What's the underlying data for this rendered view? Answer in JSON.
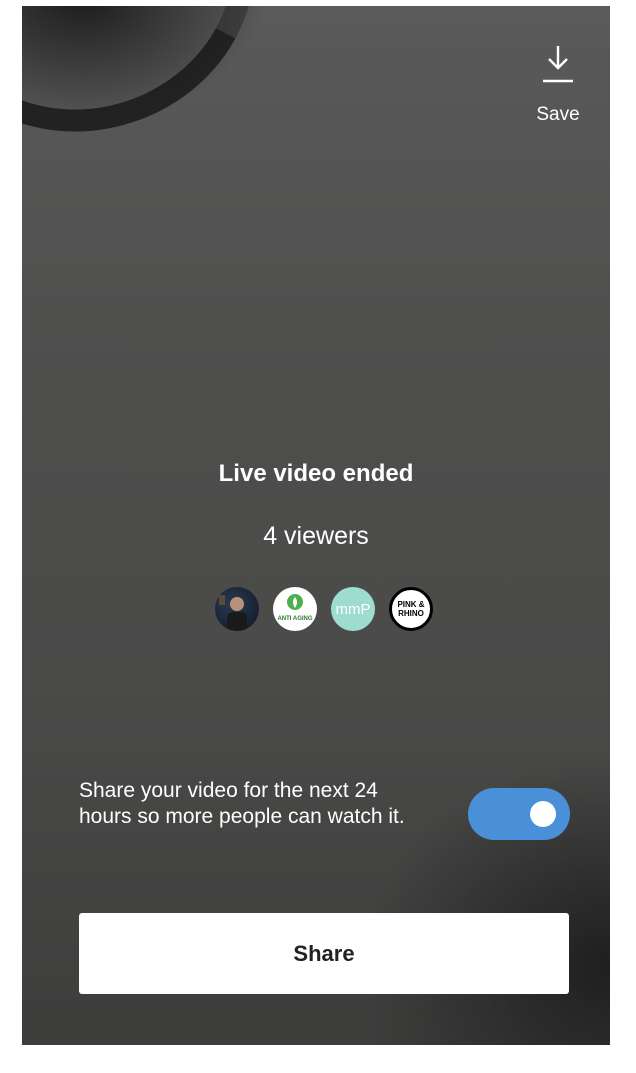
{
  "toolbar": {
    "save_label": "Save",
    "save_icon": "download-icon"
  },
  "summary": {
    "title": "Live video ended",
    "viewers": "4 viewers"
  },
  "viewer_avatars": [
    {
      "name": "viewer-1",
      "label": ""
    },
    {
      "name": "viewer-2",
      "label": "ANTI AGING"
    },
    {
      "name": "viewer-3",
      "label": "mmP"
    },
    {
      "name": "viewer-4",
      "label": "PINK & RHINO"
    }
  ],
  "share_option": {
    "text": "Share your video for the next 24 hours so more people can watch it.",
    "toggle_on": true
  },
  "share_button": {
    "label": "Share"
  },
  "colors": {
    "toggle_accent": "#4a90d9",
    "avatar_teal": "#9fdcd0"
  }
}
